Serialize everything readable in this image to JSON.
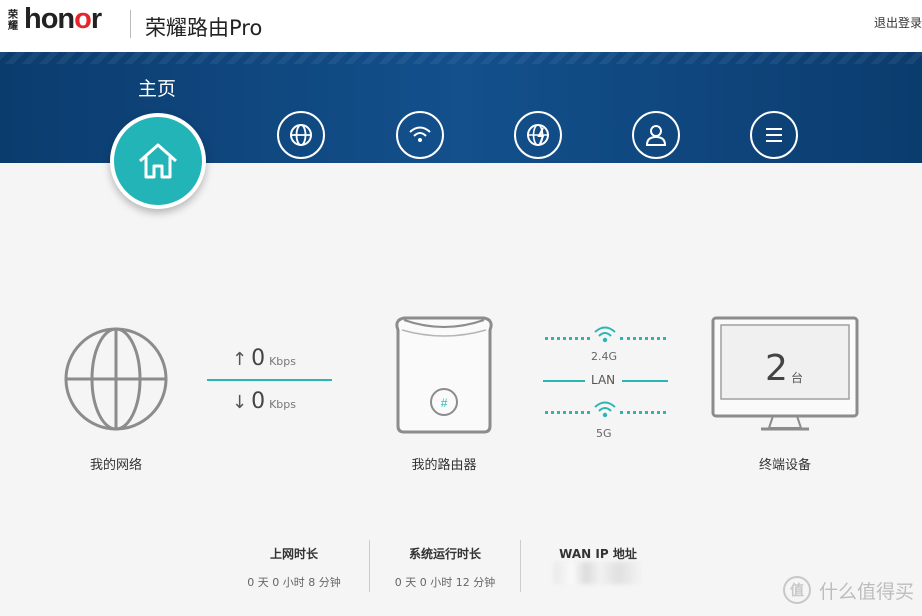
{
  "header": {
    "brand_cn": "荣耀",
    "brand_en_prefix": "hon",
    "brand_en_highlight": "o",
    "brand_en_suffix": "r",
    "app_title": "荣耀路由Pro",
    "logout_label": "退出登录"
  },
  "nav": {
    "home_label": "主页",
    "items": [
      {
        "icon": "globe-icon"
      },
      {
        "icon": "wifi-icon"
      },
      {
        "icon": "globe-lightning-icon"
      },
      {
        "icon": "user-icon"
      },
      {
        "icon": "menu-icon"
      }
    ]
  },
  "network": {
    "label": "我的网络",
    "upload_value": "0",
    "upload_unit": "Kbps",
    "download_value": "0",
    "download_unit": "Kbps"
  },
  "router": {
    "label": "我的路由器"
  },
  "links": {
    "band_24": "2.4G",
    "lan": "LAN",
    "band_5": "5G"
  },
  "devices": {
    "count": "2",
    "unit": "台",
    "label": "终端设备"
  },
  "stats": [
    {
      "title": "上网时长",
      "value": "0 天 0 小时 8 分钟"
    },
    {
      "title": "系统运行时长",
      "value": "0 天 0 小时 12 分钟"
    },
    {
      "title": "WAN IP 地址",
      "value": ""
    }
  ],
  "watermark": {
    "badge": "值",
    "text": "什么值得买"
  },
  "colors": {
    "accent": "#23b4b8",
    "nav_band": "#13508c",
    "brand_red": "#e3262c"
  }
}
